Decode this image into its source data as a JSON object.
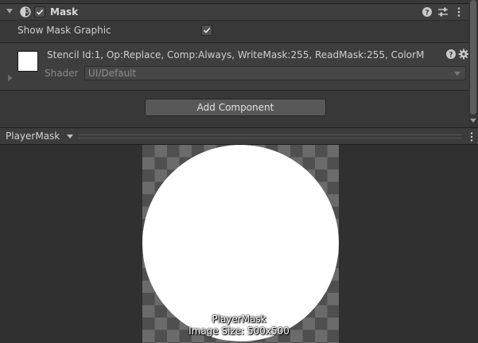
{
  "component": {
    "title": "Mask",
    "enabled": true,
    "icons": [
      "mask-component-icon",
      "help-icon",
      "preset-icon",
      "more-icon"
    ]
  },
  "properties": {
    "show_mask_graphic_label": "Show Mask Graphic",
    "show_mask_graphic": true
  },
  "material": {
    "name": "Stencil Id:1, Op:Replace, Comp:Always, WriteMask:255, ReadMask:255, ColorM",
    "shader_label": "Shader",
    "shader_value": "UI/Default",
    "icons": [
      "help-icon",
      "gear-icon"
    ]
  },
  "add_component_label": "Add Component",
  "preview": {
    "title": "PlayerMask",
    "caption_name": "PlayerMask",
    "caption_size": "Image Size: 500x500"
  },
  "colors": {
    "background": "#383838",
    "header": "#3e3e3e",
    "button": "#585858",
    "preview_bg": "#303030"
  }
}
